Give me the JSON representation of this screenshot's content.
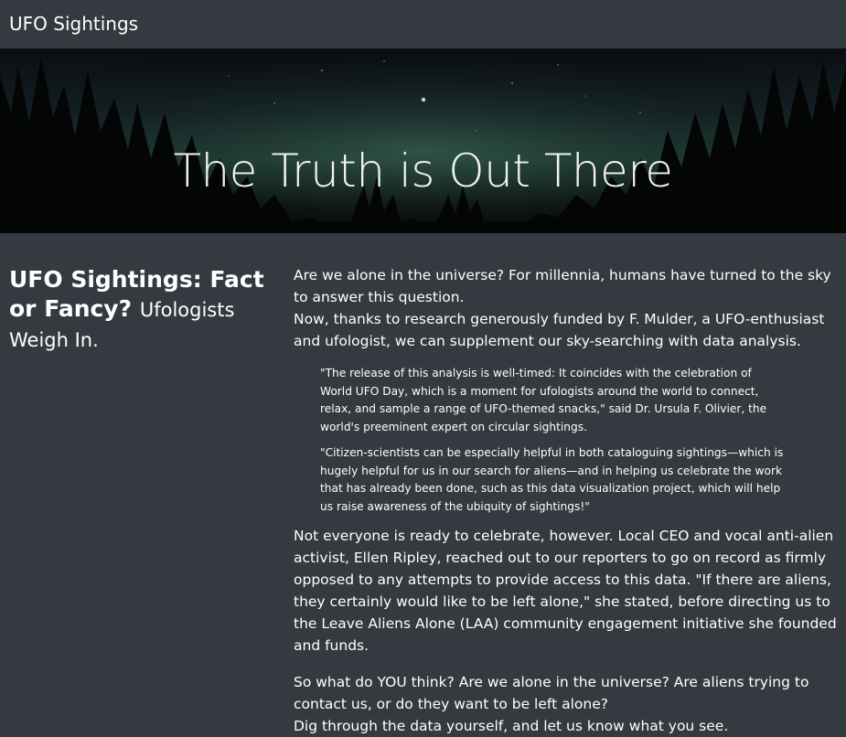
{
  "navbar": {
    "brand": "UFO Sightings"
  },
  "hero": {
    "title": "The Truth is Out There"
  },
  "sidebar": {
    "heading": "UFO Sightings: Fact or Fancy?",
    "subheading": "Ufologists Weigh In."
  },
  "article": {
    "intro_line1": "Are we alone in the universe? For millennia, humans have turned to the sky to answer this question.",
    "intro_line2": "Now, thanks to research generously funded by F. Mulder, a UFO-enthusiast and ufologist, we can supplement our sky-searching with data analysis.",
    "quote1": "\"The release of this analysis is well-timed: It coincides with the celebration of World UFO Day, which is a moment for ufologists around the world to connect, relax, and sample a range of UFO-themed snacks,\" said Dr. Ursula F. Olivier, the world's preeminent expert on circular sightings.",
    "quote2": "\"Citizen-scientists can be especially helpful in both cataloguing sightings—which is hugely helpful for us in our search for aliens—and in helping us celebrate the work that has already been done, such as this data visualization project, which will help us raise awareness of the ubiquity of sightings!\"",
    "paragraph2": "Not everyone is ready to celebrate, however. Local CEO and vocal anti-alien activist, Ellen Ripley, reached out to our reporters to go on record as firmly opposed to any attempts to provide access to this data. \"If there are aliens, they certainly would like to be left alone,\" she stated, before directing us to the Leave Aliens Alone (LAA) community engagement initiative she founded and funds.",
    "closing_line1": "So what do YOU think? Are we alone in the universe? Are aliens trying to contact us, or do they want to be left alone?",
    "closing_line2": "Dig through the data yourself, and let us know what you see."
  }
}
